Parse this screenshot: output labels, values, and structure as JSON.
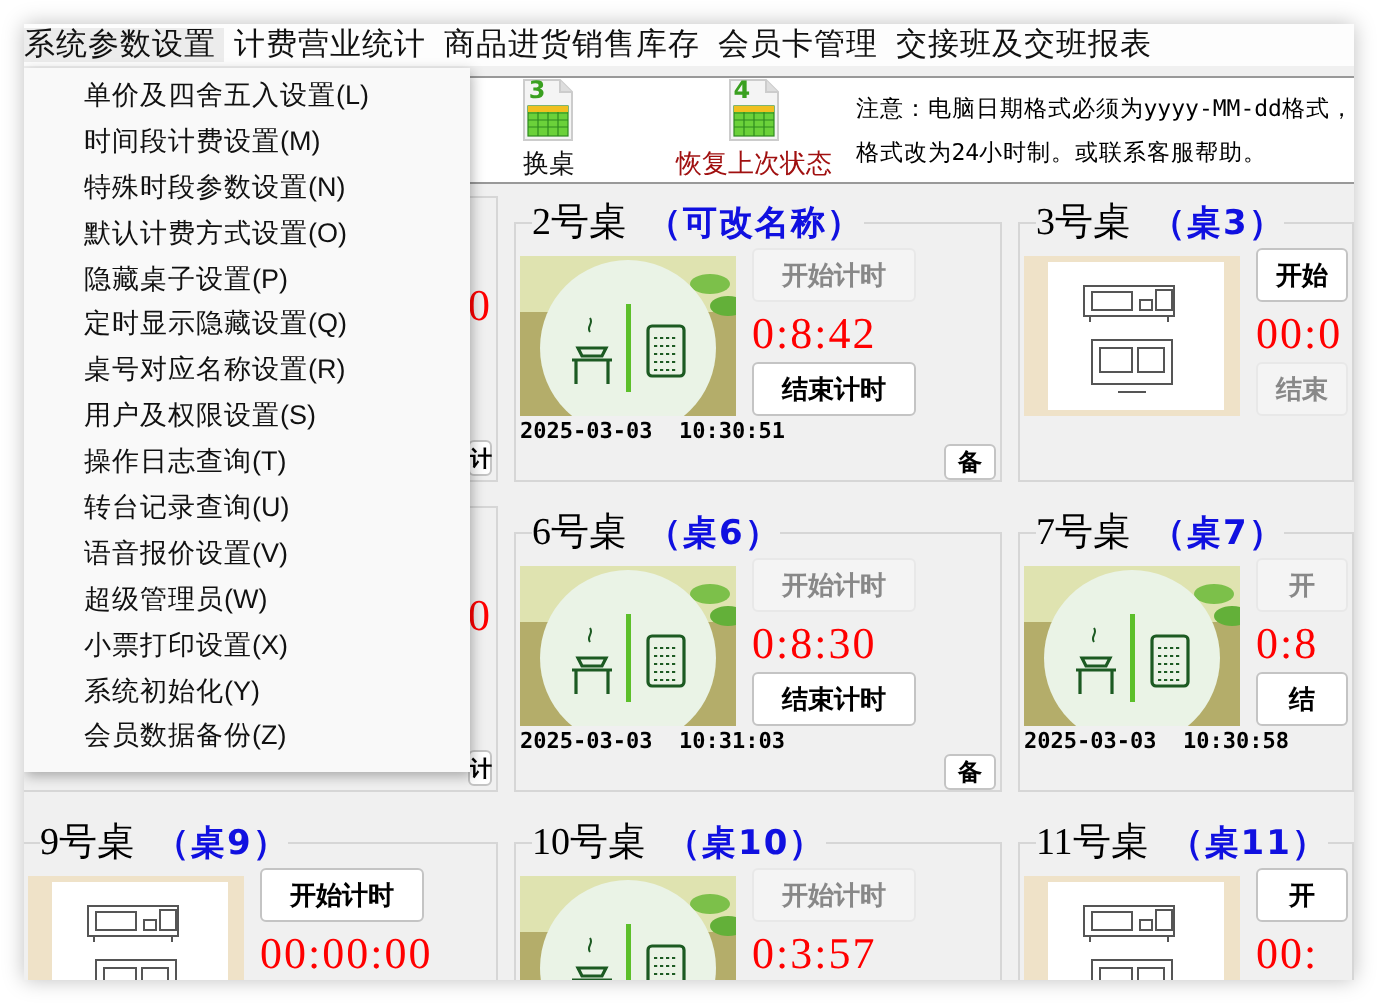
{
  "menubar": [
    {
      "label": "系统参数设置",
      "open": true,
      "items": [
        "单价及四舍五入设置(L)",
        "时间段计费设置(M)",
        "特殊时段参数设置(N)",
        "默认计费方式设置(O)",
        "隐藏桌子设置(P)",
        "定时显示隐藏设置(Q)",
        "桌号对应名称设置(R)",
        "用户及权限设置(S)",
        "操作日志查询(T)",
        "转台记录查询(U)",
        "语音报价设置(V)",
        "超级管理员(W)",
        "小票打印设置(X)",
        "系统初始化(Y)",
        "会员数据备份(Z)"
      ]
    },
    {
      "label": "计费营业统计",
      "open": false
    },
    {
      "label": "商品进货销售库存",
      "open": false
    },
    {
      "label": "会员卡管理",
      "open": false
    },
    {
      "label": "交接班及交班报表",
      "open": false
    }
  ],
  "toolbar": {
    "buttons": [
      {
        "number": "3",
        "label": "换桌",
        "kind": "normal"
      },
      {
        "number": "4",
        "label": "恢复上次状态",
        "kind": "warning"
      }
    ],
    "notice": [
      "注意：电脑日期格式必须为yyyy-MM-dd格式，",
      "格式改为24小时制。或联系客服帮助。"
    ]
  },
  "tables": [
    {
      "kind": "covered",
      "timer": "0",
      "note_button": "计"
    },
    {
      "kind": "busy",
      "name": "2号桌",
      "alias": "（可改名称）",
      "start": {
        "label": "开始计时",
        "disabled": true
      },
      "timer": "0:8:42",
      "end": {
        "label": "结束计时",
        "disabled": false
      },
      "started_at": "2025-03-03  10:30:51",
      "note_button": "备"
    },
    {
      "kind": "idle",
      "name": "3号桌",
      "alias": "（桌3）",
      "start": {
        "label": "开始",
        "disabled": false
      },
      "timer": "00:0",
      "end": {
        "label": "结束",
        "disabled": true
      }
    },
    {
      "kind": "covered",
      "timer": "0",
      "note_button": "计"
    },
    {
      "kind": "busy",
      "name": "6号桌",
      "alias": "（桌6）",
      "start": {
        "label": "开始计时",
        "disabled": true
      },
      "timer": "0:8:30",
      "end": {
        "label": "结束计时",
        "disabled": false
      },
      "started_at": "2025-03-03  10:31:03",
      "note_button": "备"
    },
    {
      "kind": "busy",
      "name": "7号桌",
      "alias": "（桌7）",
      "start": {
        "label": "开",
        "disabled": true
      },
      "timer": "0:8",
      "end": {
        "label": "结",
        "disabled": false
      },
      "started_at": "2025-03-03  10:30:58"
    },
    {
      "kind": "idle",
      "name": "9号桌",
      "alias": "（桌9）",
      "start": {
        "label": "开始计时",
        "disabled": false
      },
      "timer": "00:00:00"
    },
    {
      "kind": "busy",
      "name": "10号桌",
      "alias": "（桌10）",
      "start": {
        "label": "开始计时",
        "disabled": true
      },
      "timer": "0:3:57"
    },
    {
      "kind": "idle",
      "name": "11号桌",
      "alias": "（桌11）",
      "start": {
        "label": "开",
        "disabled": false
      },
      "timer": "00:"
    }
  ]
}
